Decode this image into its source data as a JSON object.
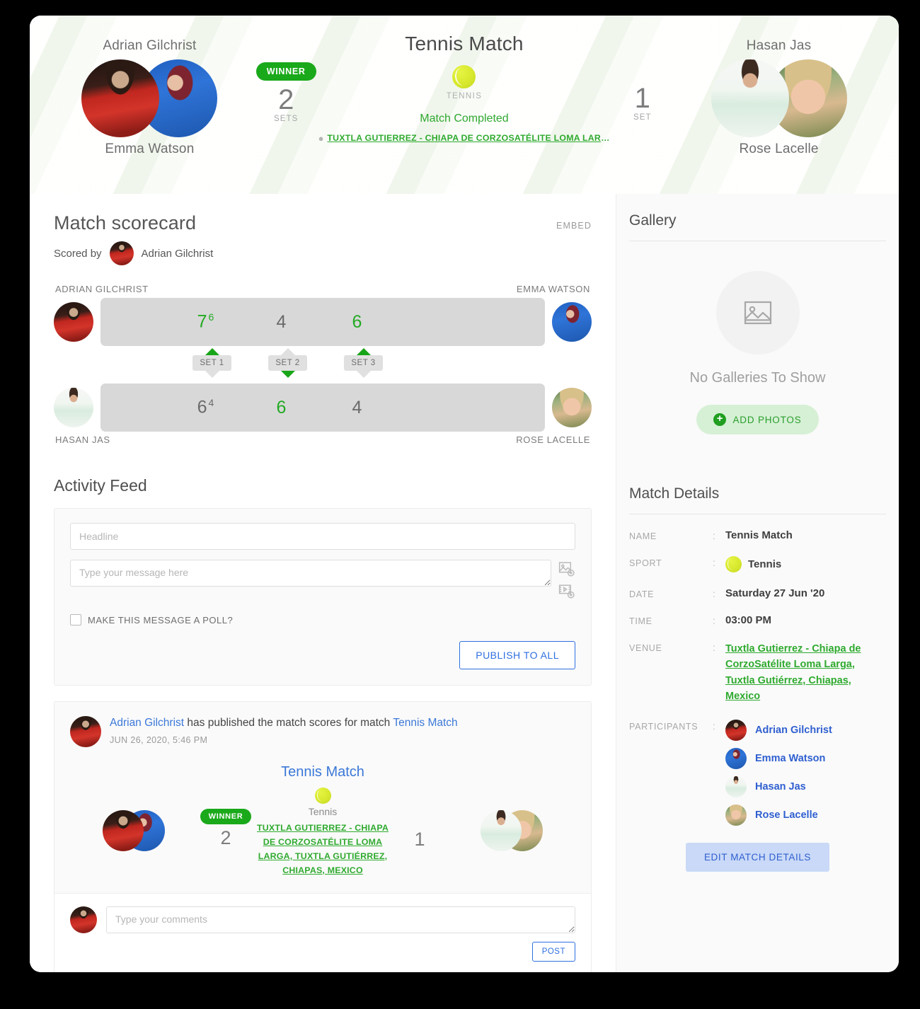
{
  "header": {
    "title": "Tennis Match",
    "sport_label": "TENNIS",
    "status": "Match Completed",
    "venue_short": "TUXTLA GUTIERREZ - CHIAPA DE CORZOSATÉLITE LOMA LARG...",
    "left": {
      "top_name": "Adrian Gilchrist",
      "bottom_name": "Emma Watson",
      "score": "2",
      "score_label": "SETS",
      "winner_badge": "WINNER"
    },
    "right": {
      "top_name": "Hasan Jas",
      "bottom_name": "Rose Lacelle",
      "score": "1",
      "score_label": "SET"
    }
  },
  "scorecard": {
    "title": "Match scorecard",
    "embed_label": "EMBED",
    "scored_by_label": "Scored by",
    "scored_by_name": "Adrian Gilchrist",
    "top_left_name": "ADRIAN GILCHRIST",
    "top_right_name": "EMMA WATSON",
    "bottom_left_name": "HASAN JAS",
    "bottom_right_name": "ROSE LACELLE",
    "sets": [
      {
        "label": "SET 1",
        "winner": "top"
      },
      {
        "label": "SET 2",
        "winner": "bottom"
      },
      {
        "label": "SET 3",
        "winner": "top"
      }
    ],
    "top_scores": [
      {
        "games": "7",
        "tiebreak": "6",
        "won": true
      },
      {
        "games": "4",
        "tiebreak": "",
        "won": false
      },
      {
        "games": "6",
        "tiebreak": "",
        "won": true
      }
    ],
    "bottom_scores": [
      {
        "games": "6",
        "tiebreak": "4",
        "won": false
      },
      {
        "games": "6",
        "tiebreak": "",
        "won": true
      },
      {
        "games": "4",
        "tiebreak": "",
        "won": false
      }
    ]
  },
  "activity_feed": {
    "title": "Activity Feed",
    "headline_placeholder": "Headline",
    "message_placeholder": "Type your message here",
    "poll_label": "MAKE THIS MESSAGE A POLL?",
    "publish_label": "PUBLISH TO ALL"
  },
  "post": {
    "author": "Adrian Gilchrist",
    "action_text": " has published the match scores for match ",
    "match_link": "Tennis Match",
    "timestamp": "JUN 26, 2020, 5:46 PM",
    "card_title": "Tennis Match",
    "sport_name": "Tennis",
    "venue": "TUXTLA GUTIERREZ - CHIAPA DE CORZOSATÉLITE LOMA LARGA, TUXTLA GUTIÉRREZ, CHIAPAS, MEXICO",
    "winner_badge": "WINNER",
    "left_score": "2",
    "right_score": "1",
    "comment_placeholder": "Type your comments",
    "post_button": "POST"
  },
  "gallery": {
    "title": "Gallery",
    "empty_text": "No Galleries To Show",
    "add_photos_label": "ADD PHOTOS"
  },
  "match_details": {
    "title": "Match Details",
    "rows": [
      {
        "label": "NAME",
        "value": "Tennis Match"
      },
      {
        "label": "SPORT",
        "value": "Tennis"
      },
      {
        "label": "DATE",
        "value": "Saturday 27 Jun '20"
      },
      {
        "label": "TIME",
        "value": "03:00 PM"
      }
    ],
    "venue_label": "VENUE",
    "venue_value": "Tuxtla Gutierrez - Chiapa de CorzoSatélite Loma Larga, Tuxtla Gutiérrez, Chiapas, Mexico",
    "participants_label": "PARTICIPANTS",
    "participants": [
      {
        "name": "Adrian Gilchrist"
      },
      {
        "name": "Emma Watson"
      },
      {
        "name": "Hasan Jas"
      },
      {
        "name": "Rose Lacelle"
      }
    ],
    "edit_button": "EDIT MATCH DETAILS"
  },
  "colors": {
    "green": "#2faa2f",
    "winner_green": "#1aa91a",
    "blue": "#2f6fe0",
    "link_blue": "#3b78d8"
  }
}
